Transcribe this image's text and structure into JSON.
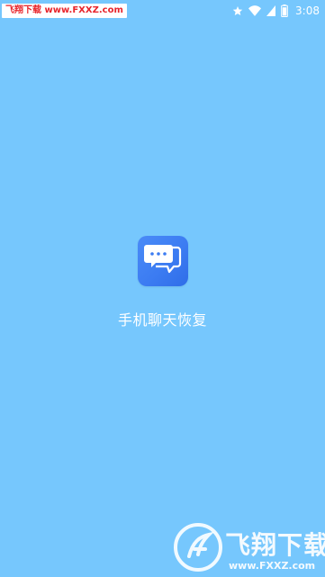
{
  "status_bar": {
    "watermark_text": "飞翔下载 www.FXXZ.com",
    "time": "3:08",
    "icons": [
      "star-icon",
      "wifi-icon",
      "battery-icon"
    ]
  },
  "splash": {
    "app_name": "手机聊天恢复",
    "icon": "chat-bubbles-icon",
    "colors": {
      "background": "#76c7fd",
      "icon_background": "#3c7cf2",
      "text": "#ffffff"
    }
  },
  "watermark": {
    "brand_text": "飞翔下载",
    "url": "www.FXXZ.com"
  }
}
